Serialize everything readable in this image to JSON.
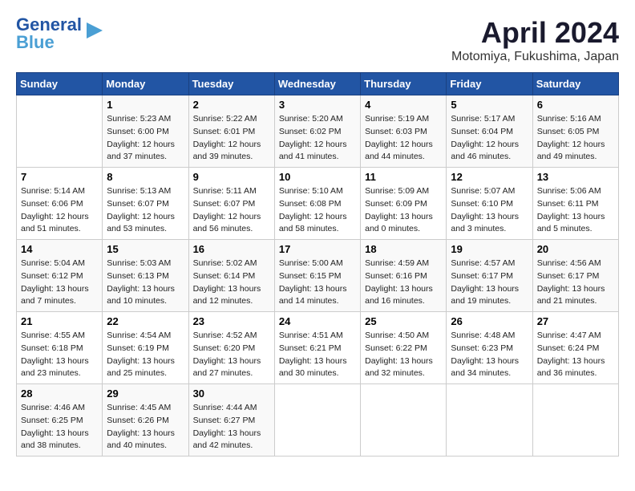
{
  "logo": {
    "line1": "General",
    "line2": "Blue"
  },
  "title": "April 2024",
  "subtitle": "Motomiya, Fukushima, Japan",
  "weekdays": [
    "Sunday",
    "Monday",
    "Tuesday",
    "Wednesday",
    "Thursday",
    "Friday",
    "Saturday"
  ],
  "weeks": [
    [
      {
        "day": "",
        "content": ""
      },
      {
        "day": "1",
        "content": "Sunrise: 5:23 AM\nSunset: 6:00 PM\nDaylight: 12 hours\nand 37 minutes."
      },
      {
        "day": "2",
        "content": "Sunrise: 5:22 AM\nSunset: 6:01 PM\nDaylight: 12 hours\nand 39 minutes."
      },
      {
        "day": "3",
        "content": "Sunrise: 5:20 AM\nSunset: 6:02 PM\nDaylight: 12 hours\nand 41 minutes."
      },
      {
        "day": "4",
        "content": "Sunrise: 5:19 AM\nSunset: 6:03 PM\nDaylight: 12 hours\nand 44 minutes."
      },
      {
        "day": "5",
        "content": "Sunrise: 5:17 AM\nSunset: 6:04 PM\nDaylight: 12 hours\nand 46 minutes."
      },
      {
        "day": "6",
        "content": "Sunrise: 5:16 AM\nSunset: 6:05 PM\nDaylight: 12 hours\nand 49 minutes."
      }
    ],
    [
      {
        "day": "7",
        "content": "Sunrise: 5:14 AM\nSunset: 6:06 PM\nDaylight: 12 hours\nand 51 minutes."
      },
      {
        "day": "8",
        "content": "Sunrise: 5:13 AM\nSunset: 6:07 PM\nDaylight: 12 hours\nand 53 minutes."
      },
      {
        "day": "9",
        "content": "Sunrise: 5:11 AM\nSunset: 6:07 PM\nDaylight: 12 hours\nand 56 minutes."
      },
      {
        "day": "10",
        "content": "Sunrise: 5:10 AM\nSunset: 6:08 PM\nDaylight: 12 hours\nand 58 minutes."
      },
      {
        "day": "11",
        "content": "Sunrise: 5:09 AM\nSunset: 6:09 PM\nDaylight: 13 hours\nand 0 minutes."
      },
      {
        "day": "12",
        "content": "Sunrise: 5:07 AM\nSunset: 6:10 PM\nDaylight: 13 hours\nand 3 minutes."
      },
      {
        "day": "13",
        "content": "Sunrise: 5:06 AM\nSunset: 6:11 PM\nDaylight: 13 hours\nand 5 minutes."
      }
    ],
    [
      {
        "day": "14",
        "content": "Sunrise: 5:04 AM\nSunset: 6:12 PM\nDaylight: 13 hours\nand 7 minutes."
      },
      {
        "day": "15",
        "content": "Sunrise: 5:03 AM\nSunset: 6:13 PM\nDaylight: 13 hours\nand 10 minutes."
      },
      {
        "day": "16",
        "content": "Sunrise: 5:02 AM\nSunset: 6:14 PM\nDaylight: 13 hours\nand 12 minutes."
      },
      {
        "day": "17",
        "content": "Sunrise: 5:00 AM\nSunset: 6:15 PM\nDaylight: 13 hours\nand 14 minutes."
      },
      {
        "day": "18",
        "content": "Sunrise: 4:59 AM\nSunset: 6:16 PM\nDaylight: 13 hours\nand 16 minutes."
      },
      {
        "day": "19",
        "content": "Sunrise: 4:57 AM\nSunset: 6:17 PM\nDaylight: 13 hours\nand 19 minutes."
      },
      {
        "day": "20",
        "content": "Sunrise: 4:56 AM\nSunset: 6:17 PM\nDaylight: 13 hours\nand 21 minutes."
      }
    ],
    [
      {
        "day": "21",
        "content": "Sunrise: 4:55 AM\nSunset: 6:18 PM\nDaylight: 13 hours\nand 23 minutes."
      },
      {
        "day": "22",
        "content": "Sunrise: 4:54 AM\nSunset: 6:19 PM\nDaylight: 13 hours\nand 25 minutes."
      },
      {
        "day": "23",
        "content": "Sunrise: 4:52 AM\nSunset: 6:20 PM\nDaylight: 13 hours\nand 27 minutes."
      },
      {
        "day": "24",
        "content": "Sunrise: 4:51 AM\nSunset: 6:21 PM\nDaylight: 13 hours\nand 30 minutes."
      },
      {
        "day": "25",
        "content": "Sunrise: 4:50 AM\nSunset: 6:22 PM\nDaylight: 13 hours\nand 32 minutes."
      },
      {
        "day": "26",
        "content": "Sunrise: 4:48 AM\nSunset: 6:23 PM\nDaylight: 13 hours\nand 34 minutes."
      },
      {
        "day": "27",
        "content": "Sunrise: 4:47 AM\nSunset: 6:24 PM\nDaylight: 13 hours\nand 36 minutes."
      }
    ],
    [
      {
        "day": "28",
        "content": "Sunrise: 4:46 AM\nSunset: 6:25 PM\nDaylight: 13 hours\nand 38 minutes."
      },
      {
        "day": "29",
        "content": "Sunrise: 4:45 AM\nSunset: 6:26 PM\nDaylight: 13 hours\nand 40 minutes."
      },
      {
        "day": "30",
        "content": "Sunrise: 4:44 AM\nSunset: 6:27 PM\nDaylight: 13 hours\nand 42 minutes."
      },
      {
        "day": "",
        "content": ""
      },
      {
        "day": "",
        "content": ""
      },
      {
        "day": "",
        "content": ""
      },
      {
        "day": "",
        "content": ""
      }
    ]
  ]
}
